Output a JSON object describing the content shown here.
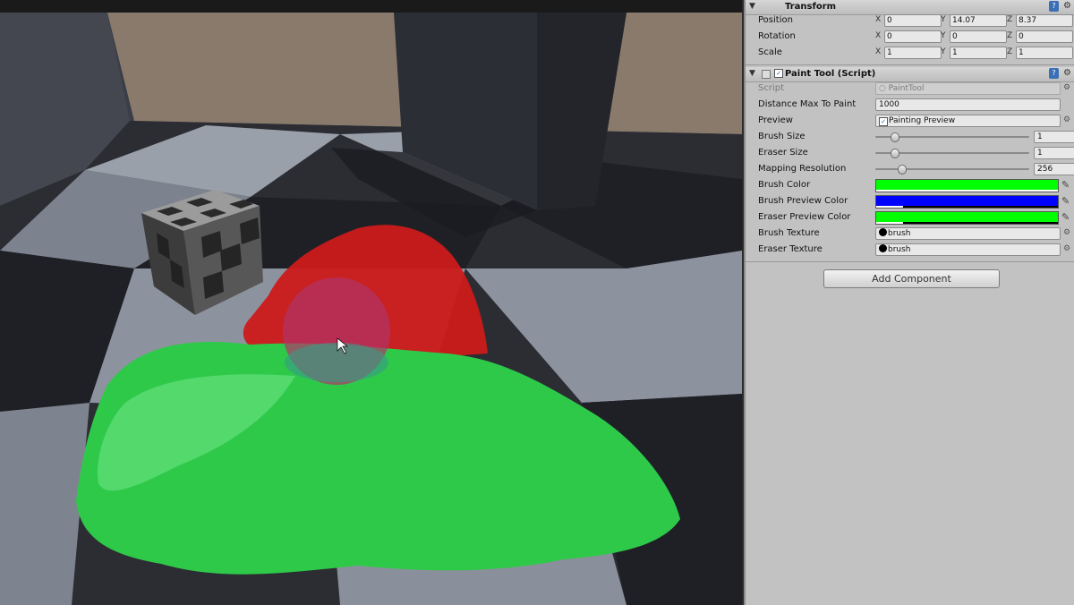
{
  "inspector": {
    "transform": {
      "title": "Transform",
      "rows": [
        {
          "label": "Position",
          "x": "0",
          "y": "14.07",
          "z": "8.37"
        },
        {
          "label": "Rotation",
          "x": "0",
          "y": "0",
          "z": "0"
        },
        {
          "label": "Scale",
          "x": "1",
          "y": "1",
          "z": "1"
        }
      ],
      "axis_labels": {
        "x": "X",
        "y": "Y",
        "z": "Z"
      }
    },
    "paint_tool": {
      "title": "Paint Tool (Script)",
      "enabled": "✓",
      "script": {
        "label": "Script",
        "value": "PaintTool"
      },
      "distance": {
        "label": "Distance Max To Paint",
        "value": "1000"
      },
      "preview": {
        "label": "Preview",
        "value": "Painting Preview",
        "check": "✓"
      },
      "brush_size": {
        "label": "Brush Size",
        "value": "1",
        "fraction": 0.1
      },
      "eraser_size": {
        "label": "Eraser Size",
        "value": "1",
        "fraction": 0.1
      },
      "mapping_resolution": {
        "label": "Mapping Resolution",
        "value": "256",
        "fraction": 0.15
      },
      "brush_color": {
        "label": "Brush Color",
        "color": "#00ff00",
        "alpha": 1.0
      },
      "brush_preview_color": {
        "label": "Brush Preview Color",
        "color": "#0000ff",
        "alpha": 0.15
      },
      "eraser_preview_color": {
        "label": "Eraser Preview Color",
        "color": "#00ff00",
        "alpha": 0.15
      },
      "brush_texture": {
        "label": "Brush Texture",
        "value": "brush"
      },
      "eraser_texture": {
        "label": "Eraser Texture",
        "value": "brush"
      }
    },
    "add_component_label": "Add Component"
  },
  "icons": {
    "fold": "▼",
    "book": "?",
    "gear": "⚙",
    "picker": "✎",
    "settings_small": "⚙"
  },
  "colors": {
    "paint_green": "#2fc94a",
    "paint_red": "#d01818",
    "brush_preview": "#b0346a"
  }
}
